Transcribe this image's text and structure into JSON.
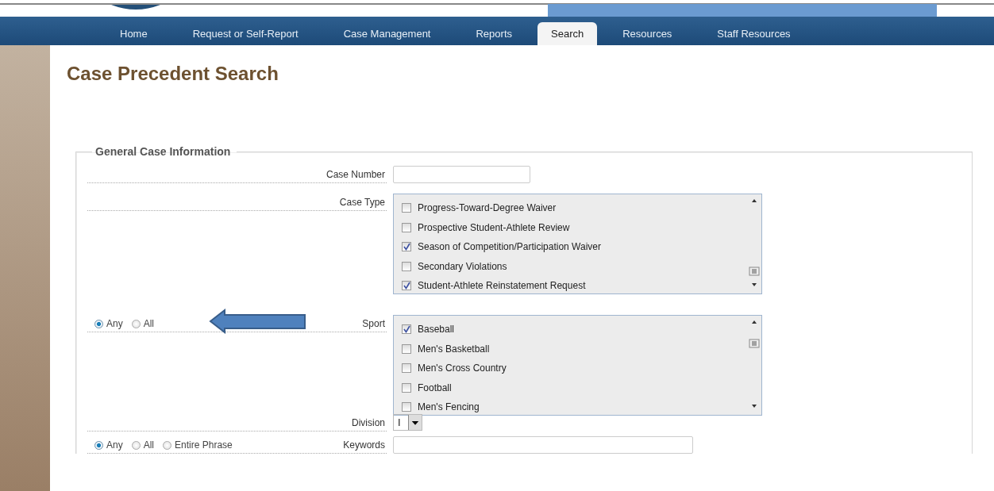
{
  "nav": [
    {
      "label": "Home",
      "selected": false
    },
    {
      "label": "Request or Self-Report",
      "selected": false
    },
    {
      "label": "Case Management",
      "selected": false
    },
    {
      "label": "Reports",
      "selected": false
    },
    {
      "label": "Search",
      "selected": true
    },
    {
      "label": "Resources",
      "selected": false
    },
    {
      "label": "Staff Resources",
      "selected": false
    }
  ],
  "title": "Case Precedent Search",
  "section": {
    "legend": "General Case Information",
    "fields": [
      {
        "kind": "text",
        "label": "Case Number"
      },
      {
        "kind": "checklist",
        "label": "Case Type",
        "items": [
          {
            "label": "Progress-Toward-Degree Waiver",
            "checked": false
          },
          {
            "label": "Prospective Student-Athlete Review",
            "checked": false
          },
          {
            "label": "Season of Competition/Participation Waiver",
            "checked": true
          },
          {
            "label": "Secondary Violations",
            "checked": false
          },
          {
            "label": "Student-Athlete Reinstatement Request",
            "checked": true
          }
        ]
      },
      {
        "kind": "checklist",
        "label": "Sport",
        "match": [
          {
            "label": "Any",
            "selected": true
          },
          {
            "label": "All",
            "selected": false
          }
        ],
        "annotation_arrow": true,
        "items": [
          {
            "label": "Baseball",
            "checked": true
          },
          {
            "label": "Men's Basketball",
            "checked": false
          },
          {
            "label": "Men's Cross Country",
            "checked": false
          },
          {
            "label": "Football",
            "checked": false
          },
          {
            "label": "Men's Fencing",
            "checked": false
          }
        ]
      },
      {
        "kind": "select",
        "label": "Division",
        "value": "I"
      },
      {
        "kind": "text",
        "label": "Keywords",
        "match": [
          {
            "label": "Any",
            "selected": true
          },
          {
            "label": "All",
            "selected": false
          },
          {
            "label": "Entire Phrase",
            "selected": false
          }
        ]
      }
    ]
  }
}
